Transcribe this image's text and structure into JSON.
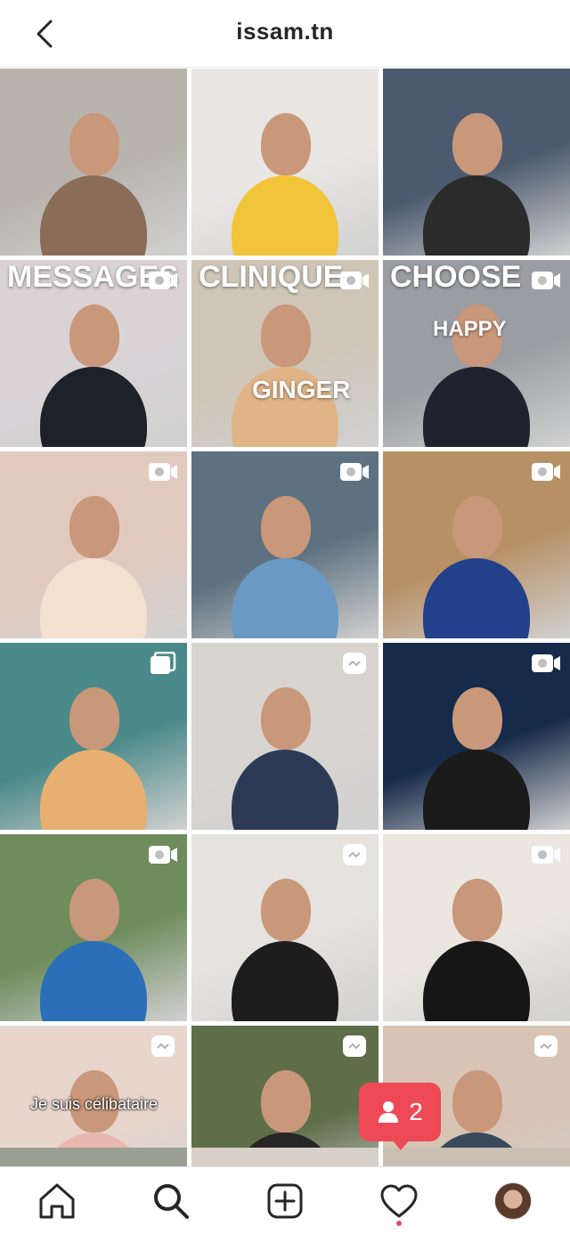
{
  "header": {
    "title": "issam.tn"
  },
  "tiles": [
    {
      "row": 0,
      "col": 0,
      "bg": "#b8b4ad",
      "accent": "#8a6c58",
      "overlay": "",
      "badge": "none"
    },
    {
      "row": 0,
      "col": 1,
      "bg": "#e9e6e4",
      "accent": "#f2c43a",
      "overlay": "",
      "badge": "none"
    },
    {
      "row": 0,
      "col": 2,
      "bg": "#4b5a6e",
      "accent": "#2b2b2b",
      "overlay": "",
      "badge": "none"
    },
    {
      "row": 1,
      "col": 0,
      "bg": "#d9d3d6",
      "accent": "#1d2228",
      "overlay": "MESSAGES",
      "badge": "video"
    },
    {
      "row": 1,
      "col": 1,
      "bg": "#cfc6b8",
      "accent": "#e0b486",
      "overlay": "CLINIQUE",
      "overlay2": "GINGER",
      "badge": "video"
    },
    {
      "row": 1,
      "col": 2,
      "bg": "#9a9da1",
      "accent": "#1f2330",
      "overlay": "CHOOSE",
      "overlay2": "HAPPY",
      "badge": "video"
    },
    {
      "row": 2,
      "col": 0,
      "bg": "#e2c9bd",
      "accent": "#f4e0cf",
      "overlay": "",
      "badge": "video"
    },
    {
      "row": 2,
      "col": 1,
      "bg": "#5d7180",
      "accent": "#6a9ac4",
      "overlay": "",
      "badge": "video"
    },
    {
      "row": 2,
      "col": 2,
      "bg": "#b89066",
      "accent": "#23408a",
      "overlay": "",
      "badge": "video"
    },
    {
      "row": 3,
      "col": 0,
      "bg": "#4b8a8a",
      "accent": "#e8b070",
      "overlay": "",
      "badge": "carousel"
    },
    {
      "row": 3,
      "col": 1,
      "bg": "#d8d4cf",
      "accent": "#2d3a55",
      "overlay": "",
      "badge": "reel"
    },
    {
      "row": 3,
      "col": 2,
      "bg": "#162a4a",
      "accent": "#1a1a1a",
      "overlay": "",
      "badge": "video"
    },
    {
      "row": 4,
      "col": 0,
      "bg": "#6e8c5c",
      "accent": "#2b6fb8",
      "overlay": "",
      "badge": "video"
    },
    {
      "row": 4,
      "col": 1,
      "bg": "#e6e3de",
      "accent": "#1d1d1d",
      "overlay": "",
      "badge": "reel"
    },
    {
      "row": 4,
      "col": 2,
      "bg": "#ebe6e0",
      "accent": "#161616",
      "overlay": "",
      "badge": "video"
    },
    {
      "row": 5,
      "col": 0,
      "bg": "#e8d6cc",
      "accent": "#e8b8b0",
      "overlay": "Je suis célibataire",
      "badge": "reel"
    },
    {
      "row": 5,
      "col": 1,
      "bg": "#5e6e48",
      "accent": "#262626",
      "overlay": "",
      "badge": "reel"
    },
    {
      "row": 5,
      "col": 2,
      "bg": "#d8c4b4",
      "accent": "#3a4a5a",
      "overlay": "",
      "badge": "reel"
    }
  ],
  "notification": {
    "count": "2"
  },
  "nav": {
    "items": [
      {
        "name": "home-icon"
      },
      {
        "name": "search-icon"
      },
      {
        "name": "new-post-icon"
      },
      {
        "name": "activity-heart-icon"
      },
      {
        "name": "profile-avatar"
      }
    ]
  },
  "colors": {
    "accent_red": "#ed4956",
    "text": "#262626"
  }
}
